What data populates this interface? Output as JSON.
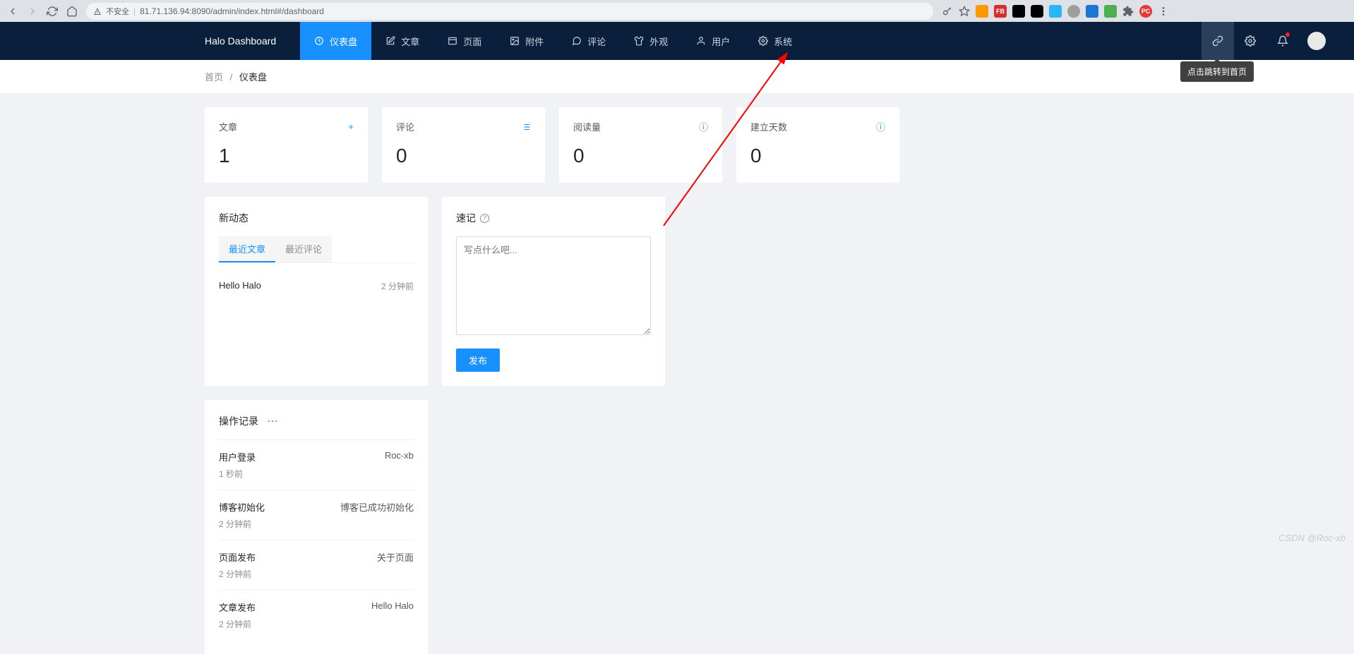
{
  "browser": {
    "security_label": "不安全",
    "url": "81.71.136.94:8090/admin/index.html#/dashboard"
  },
  "brand": "Halo  Dashboard",
  "nav": [
    {
      "label": "仪表盘"
    },
    {
      "label": "文章"
    },
    {
      "label": "页面"
    },
    {
      "label": "附件"
    },
    {
      "label": "评论"
    },
    {
      "label": "外观"
    },
    {
      "label": "用户"
    },
    {
      "label": "系统"
    }
  ],
  "tooltip": "点击跳转到首页",
  "breadcrumb": {
    "home": "首页",
    "sep": "/",
    "current": "仪表盘"
  },
  "stats": [
    {
      "label": "文章",
      "value": "1"
    },
    {
      "label": "评论",
      "value": "0"
    },
    {
      "label": "阅读量",
      "value": "0"
    },
    {
      "label": "建立天数",
      "value": "0"
    }
  ],
  "trends": {
    "title": "新动态",
    "tabs": [
      {
        "label": "最近文章"
      },
      {
        "label": "最近评论"
      }
    ],
    "items": [
      {
        "title": "Hello Halo",
        "time": "2 分钟前"
      }
    ]
  },
  "quick": {
    "title": "速记",
    "placeholder": "写点什么吧...",
    "publish": "发布"
  },
  "logs": {
    "title": "操作记录",
    "items": [
      {
        "title": "用户登录",
        "time": "1 秒前",
        "right": "Roc-xb"
      },
      {
        "title": "博客初始化",
        "time": "2 分钟前",
        "right": "博客已成功初始化"
      },
      {
        "title": "页面发布",
        "time": "2 分钟前",
        "right": "关于页面"
      },
      {
        "title": "文章发布",
        "time": "2 分钟前",
        "right": "Hello Halo"
      }
    ]
  },
  "watermark": "CSDN @Roc-xb"
}
